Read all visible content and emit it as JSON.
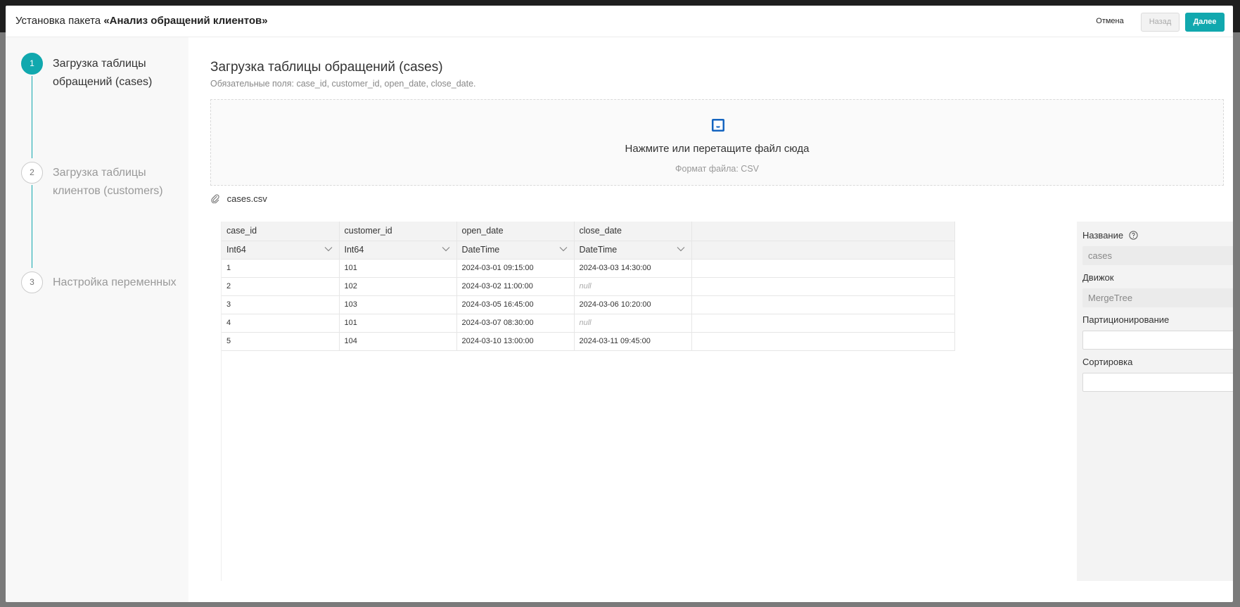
{
  "window": {
    "title_prefix": "Установка пакета",
    "title_name": "«Анализ обращений клиентов»"
  },
  "buttons": {
    "cancel": "Отмена",
    "back": "Назад",
    "next": "Далее"
  },
  "steps": [
    {
      "number": "1",
      "label": "Загрузка таблицы обращений (cases)",
      "active": true
    },
    {
      "number": "2",
      "label": "Загрузка таблицы клиентов (customers)",
      "active": false
    },
    {
      "number": "3",
      "label": "Настройка переменных",
      "active": false
    }
  ],
  "main": {
    "heading": "Загрузка таблицы обращений (cases)",
    "required_fields": "Обязательные поля: case_id, customer_id, open_date, close_date.",
    "dropzone_text": "Нажмите или перетащите файл сюда",
    "dropzone_hint": "Формат файла: CSV",
    "file_name": "cases.csv"
  },
  "table": {
    "columns": [
      {
        "name": "case_id",
        "type": "Int64"
      },
      {
        "name": "customer_id",
        "type": "Int64"
      },
      {
        "name": "open_date",
        "type": "DateTime"
      },
      {
        "name": "close_date",
        "type": "DateTime"
      }
    ],
    "rows": [
      [
        "1",
        "101",
        "2024-03-01 09:15:00",
        "2024-03-03 14:30:00"
      ],
      [
        "2",
        "102",
        "2024-03-02 11:00:00",
        "null"
      ],
      [
        "3",
        "103",
        "2024-03-05 16:45:00",
        "2024-03-06 10:20:00"
      ],
      [
        "4",
        "101",
        "2024-03-07 08:30:00",
        "null"
      ],
      [
        "5",
        "104",
        "2024-03-10 13:00:00",
        "2024-03-11 09:45:00"
      ]
    ]
  },
  "properties": {
    "name_label": "Название",
    "name_value": "cases",
    "engine_label": "Движок",
    "engine_value": "MergeTree",
    "partition_label": "Партиционирование",
    "partition_value": "",
    "sort_label": "Сортировка",
    "sort_value": ""
  },
  "colors": {
    "accent": "#11a8ae"
  },
  "icons": {
    "dropzone": "inbox-icon",
    "file": "paperclip-icon",
    "help": "question-circle-icon",
    "type_select": "chevron-down-icon"
  }
}
